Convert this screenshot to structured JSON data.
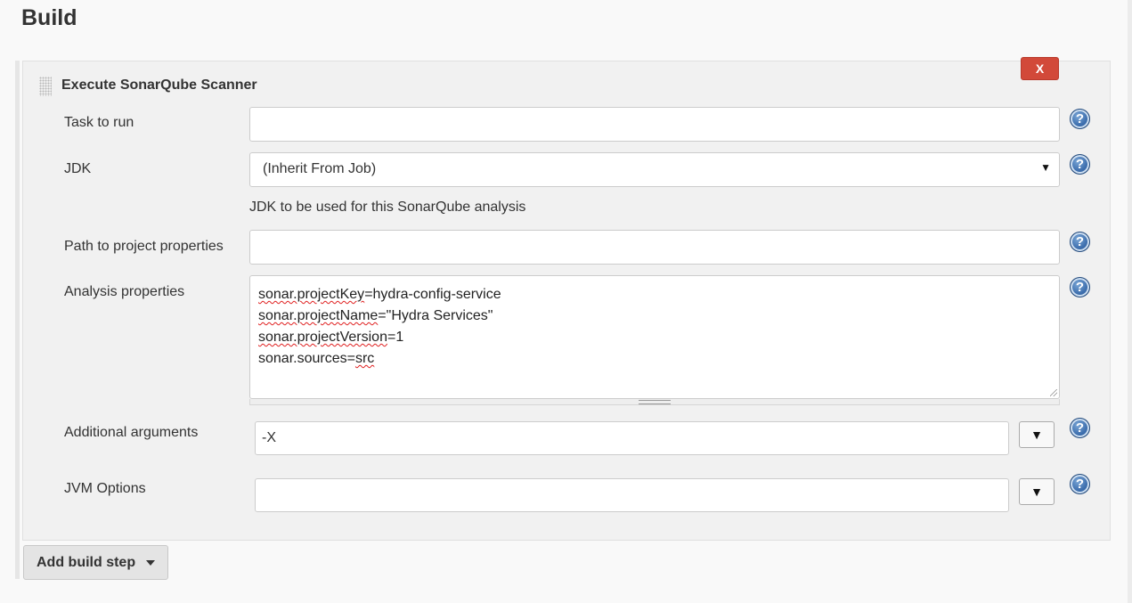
{
  "section": {
    "title": "Build"
  },
  "step": {
    "title": "Execute SonarQube Scanner",
    "delete_label": "X"
  },
  "fields": {
    "task_to_run": {
      "label": "Task to run",
      "value": ""
    },
    "jdk": {
      "label": "JDK",
      "selected": "(Inherit From Job)",
      "hint": "JDK to be used for this SonarQube analysis"
    },
    "project_properties_path": {
      "label": "Path to project properties",
      "value": ""
    },
    "analysis_properties": {
      "label": "Analysis properties",
      "lines": [
        {
          "key": "sonar.projectKey",
          "value": "hydra-config-service"
        },
        {
          "key": "sonar.projectName",
          "value": "\"Hydra Services\""
        },
        {
          "key": "sonar.projectVersion",
          "value": "1"
        },
        {
          "key": "sonar.sources",
          "value": "src"
        }
      ]
    },
    "additional_arguments": {
      "label": "Additional arguments",
      "value": "-X"
    },
    "jvm_options": {
      "label": "JVM Options",
      "value": ""
    }
  },
  "help_icon_glyph": "?",
  "expand_glyph": "▼",
  "select_arrow_glyph": "▼",
  "add_build_step": {
    "label": "Add build step"
  },
  "colors": {
    "delete_button": "#d24939",
    "help_icon": "#3e6fae",
    "spellcheck_underline": "#e02020"
  }
}
